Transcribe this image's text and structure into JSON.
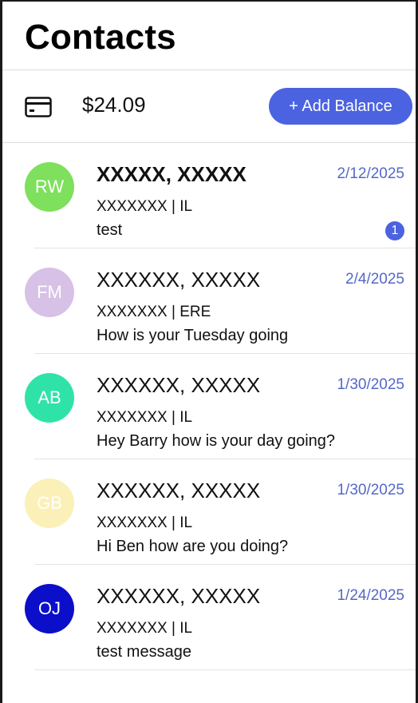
{
  "header": {
    "title": "Contacts"
  },
  "balance": {
    "icon": "credit-card-icon",
    "amount": "$24.09",
    "add_label": "+ Add Balance"
  },
  "colors": {
    "accent": "#4b63e0",
    "date": "#5468c8"
  },
  "contacts": [
    {
      "initials": "RW",
      "avatar_color": "#7ee05c",
      "name": "XXXXX, XXXXX",
      "bold": true,
      "date": "2/12/2025",
      "subtitle": "XXXXXXX | IL",
      "message": "test",
      "unread": "1"
    },
    {
      "initials": "FM",
      "avatar_color": "#d7c1e6",
      "name": "XXXXXX, XXXXX",
      "bold": false,
      "date": "2/4/2025",
      "subtitle": "XXXXXXX | ERE",
      "message": "How is your Tuesday going",
      "unread": ""
    },
    {
      "initials": "AB",
      "avatar_color": "#2fe3a8",
      "name": "XXXXXX, XXXXX",
      "bold": false,
      "date": "1/30/2025",
      "subtitle": "XXXXXXX | IL",
      "message": "Hey Barry how is your day going?",
      "unread": ""
    },
    {
      "initials": "GB",
      "avatar_color": "#fbf0b8",
      "name": "XXXXXX, XXXXX",
      "bold": false,
      "date": "1/30/2025",
      "subtitle": "XXXXXXX | IL",
      "message": "Hi Ben how are you doing?",
      "unread": ""
    },
    {
      "initials": "OJ",
      "avatar_color": "#0c0fc9",
      "name": "XXXXXX, XXXXX",
      "bold": false,
      "date": "1/24/2025",
      "subtitle": "XXXXXXX | IL",
      "message": "test message",
      "unread": ""
    }
  ]
}
